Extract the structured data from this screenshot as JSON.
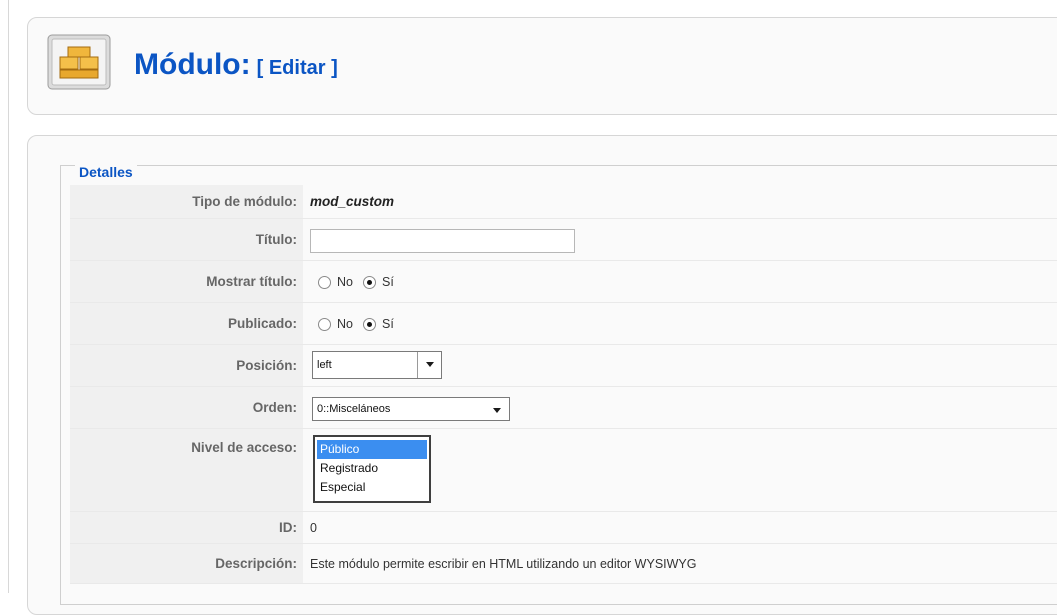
{
  "header": {
    "title": "Módulo:",
    "subtitle": "[ Editar ]",
    "icon": "module-icon"
  },
  "details": {
    "legend": "Detalles",
    "module_type": {
      "label": "Tipo de módulo:",
      "value": "mod_custom"
    },
    "title_field": {
      "label": "Título:",
      "value": "",
      "placeholder": ""
    },
    "show_title": {
      "label": "Mostrar título:",
      "options": [
        "No",
        "Sí"
      ],
      "selected": "Sí"
    },
    "published": {
      "label": "Publicado:",
      "options": [
        "No",
        "Sí"
      ],
      "selected": "Sí"
    },
    "position": {
      "label": "Posición:",
      "value": "left"
    },
    "order": {
      "label": "Orden:",
      "value": "0::Misceláneos"
    },
    "access_level": {
      "label": "Nivel de acceso:",
      "options": [
        "Público",
        "Registrado",
        "Especial"
      ],
      "selected": "Público"
    },
    "id": {
      "label": "ID:",
      "value": "0"
    },
    "description": {
      "label": "Descripción:",
      "value": "Este módulo permite escribir en HTML utilizando un editor WYSIWYG"
    }
  },
  "colors": {
    "accent": "#0b55c4",
    "selection": "#3b8ef0"
  }
}
